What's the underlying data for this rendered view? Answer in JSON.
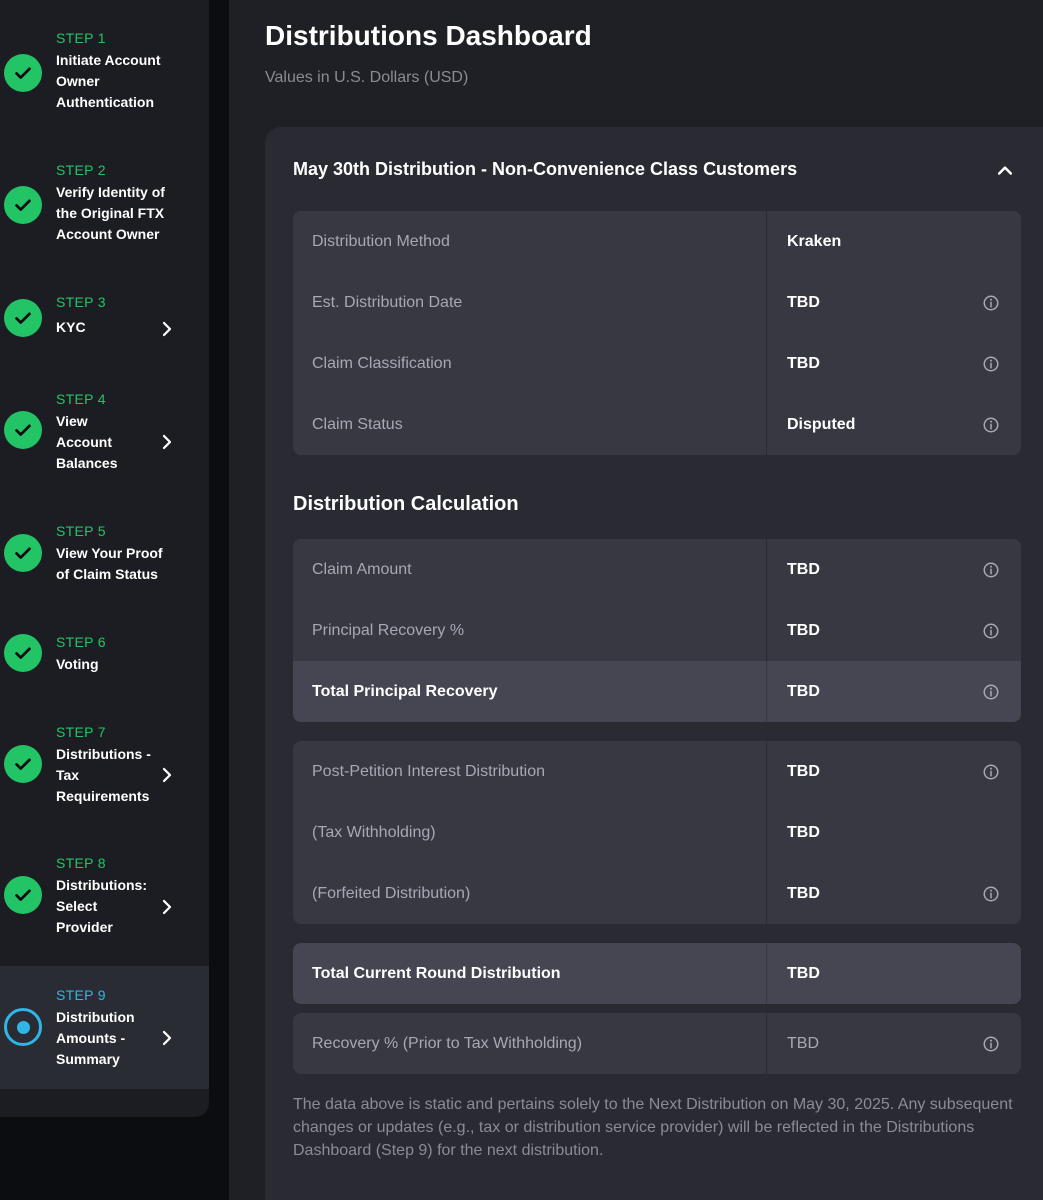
{
  "sidebar": {
    "steps": [
      {
        "num": "STEP 1",
        "title": "Initiate Account Owner Authentication",
        "status": "done"
      },
      {
        "num": "STEP 2",
        "title": "Verify Identity of the Original FTX Account Owner",
        "status": "done"
      },
      {
        "num": "STEP 3",
        "title": "KYC",
        "status": "done"
      },
      {
        "num": "STEP 4",
        "title": "View Account Balances",
        "status": "done"
      },
      {
        "num": "STEP 5",
        "title": "View Your Proof of Claim Status",
        "status": "done"
      },
      {
        "num": "STEP 6",
        "title": "Voting",
        "status": "done"
      },
      {
        "num": "STEP 7",
        "title": "Distributions - Tax Requirements",
        "status": "done"
      },
      {
        "num": "STEP 8",
        "title": "Distributions: Select Provider",
        "status": "done"
      },
      {
        "num": "STEP 9",
        "title": "Distribution Amounts - Summary",
        "status": "current"
      }
    ]
  },
  "header": {
    "title": "Distributions Dashboard",
    "subtitle": "Values in U.S. Dollars (USD)"
  },
  "card": {
    "title": "May 30th Distribution - Non-Convenience Class Customers",
    "details": [
      {
        "label": "Distribution Method",
        "value": "Kraken"
      },
      {
        "label": "Est. Distribution Date",
        "value": "TBD"
      },
      {
        "label": "Claim Classification",
        "value": "TBD"
      },
      {
        "label": "Claim Status",
        "value": "Disputed"
      }
    ],
    "calc_title": "Distribution Calculation",
    "calc_principal": [
      {
        "label": "Claim Amount",
        "value": "TBD"
      },
      {
        "label": "Principal Recovery %",
        "value": "TBD"
      },
      {
        "label": "Total Principal Recovery",
        "value": "TBD"
      }
    ],
    "calc_interest": [
      {
        "label": "Post-Petition Interest Distribution",
        "value": "TBD"
      },
      {
        "label": "(Tax Withholding)",
        "value": "TBD"
      },
      {
        "label": "(Forfeited Distribution)",
        "value": "TBD"
      }
    ],
    "total": {
      "label": "Total Current Round Distribution",
      "value": "TBD"
    },
    "recovery": {
      "label": "Recovery % (Prior to Tax Withholding)",
      "value": "TBD"
    },
    "footnote": "The data above is static and pertains solely to the Next Distribution on May 30, 2025. Any subsequent changes or updates (e.g., tax or distribution service provider) will be reflected in the Distributions Dashboard (Step 9) for the next distribution."
  },
  "colors": {
    "accent_green": "#22c466",
    "accent_blue": "#2fb5e8",
    "panel": "#2a2b32",
    "row": "#373842"
  },
  "icons": [
    "check-icon",
    "chevron-right-icon",
    "chevron-up-icon",
    "info-icon",
    "radio-current-icon"
  ]
}
